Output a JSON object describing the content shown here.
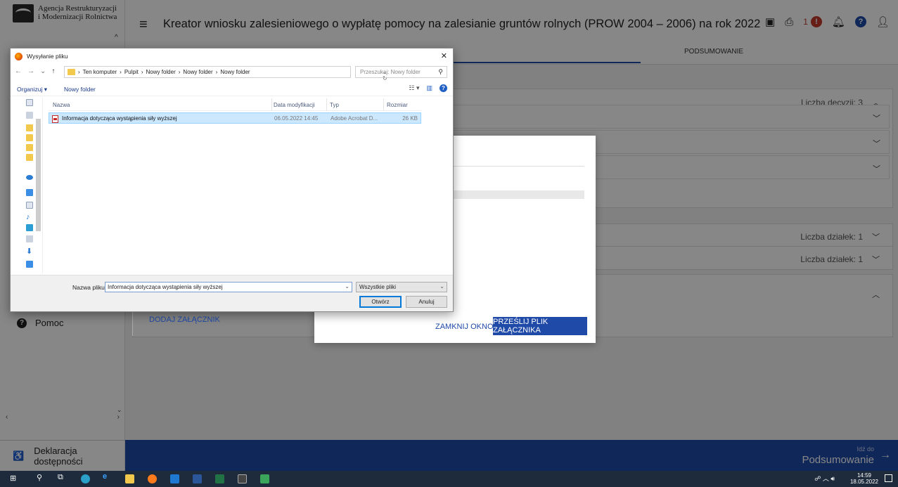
{
  "app": {
    "logo_line1": "Agencja Restrukturyzacji",
    "logo_line2": "i Modernizacji Rolnictwa",
    "title": "Kreator wniosku zalesieniowego o wypłatę pomocy na zalesianie gruntów rolnych (PROW 2004 – 2006) na rok 2022",
    "alert_count": "1",
    "tab_summary": "PODSUMOWANIE",
    "decisions_label": "Liczba decyzji: 3",
    "plots_label_1": "Liczba działek: 1",
    "plots_label_2": "Liczba działek: 1",
    "add_attachment": "DODAJ ZAŁĄCZNIK",
    "help": "Pomoc",
    "accessibility": "Deklaracja dostępności",
    "goto_small": "Idź do",
    "goto_big": "Podsumowanie"
  },
  "modal": {
    "close_label": "ZAMKNIJ OKNO",
    "send_label": "PRZEŚLIJ PLIK ZAŁĄCZNIKA"
  },
  "dialog": {
    "title": "Wysyłanie pliku",
    "breadcrumbs": [
      "Ten komputer",
      "Pulpit",
      "Nowy folder",
      "Nowy folder",
      "Nowy folder"
    ],
    "search_placeholder": "Przeszukaj: Nowy folder",
    "organize": "Organizuj ▾",
    "new_folder": "Nowy folder",
    "columns": [
      "Nazwa",
      "Data modyfikacji",
      "Typ",
      "Rozmiar"
    ],
    "files": [
      {
        "name": "Informacja dotycząca wystąpienia siły wyższej",
        "modified": "06.05.2022 14:45",
        "type": "Adobe Acrobat D...",
        "size": "26 KB"
      }
    ],
    "filename_label": "Nazwa pliku:",
    "filename_value": "Informacja dotycząca wystąpienia siły wyższej",
    "filter": "Wszystkie pliki",
    "open_label": "Otwórz",
    "cancel_label": "Anuluj"
  },
  "taskbar": {
    "time": "14:59",
    "date": "18.05.2022"
  },
  "colors": {
    "primary": "#1f4aa8",
    "alert": "#c0392b",
    "selection": "#cce8ff"
  }
}
